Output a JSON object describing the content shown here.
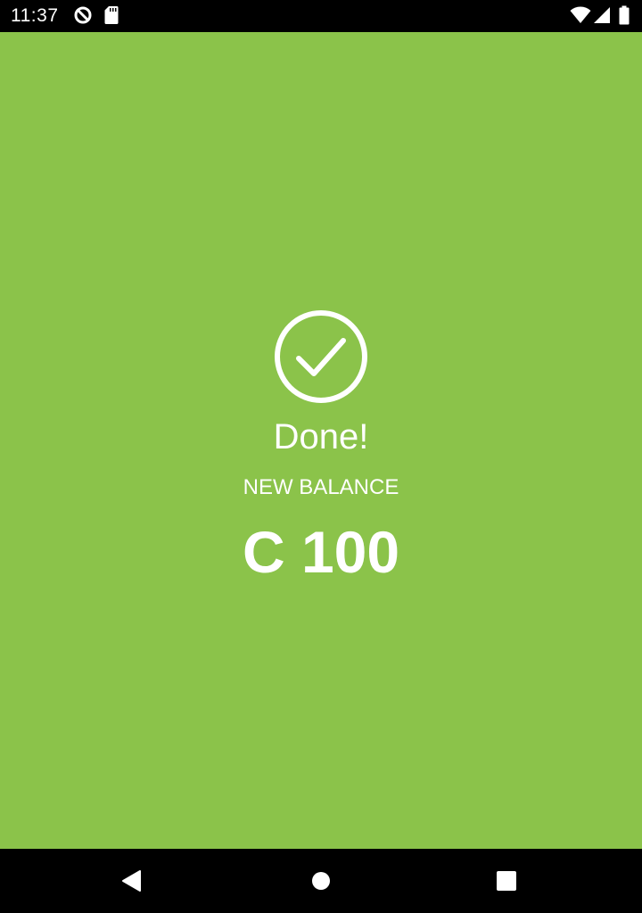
{
  "status_bar": {
    "time": "11:37",
    "icons": [
      "data-saver-icon",
      "sd-card-icon",
      "wifi-icon",
      "cell-signal-icon",
      "battery-icon"
    ]
  },
  "main": {
    "title": "Done!",
    "balance_label": "NEW BALANCE",
    "balance_value": "C 100",
    "icon": "check-circle-icon",
    "background_color": "#8bc34a",
    "text_color": "#ffffff"
  },
  "nav_bar": {
    "buttons": [
      "back-icon",
      "home-icon",
      "recents-icon"
    ]
  }
}
